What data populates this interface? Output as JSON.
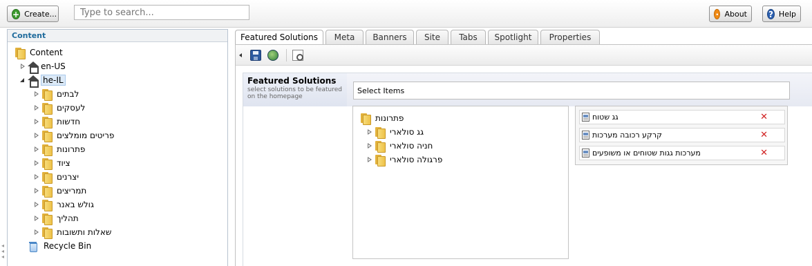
{
  "topbar": {
    "create_label": "Create...",
    "search_placeholder": "Type to search...",
    "about_label": "About",
    "help_label": "Help"
  },
  "content_tree": {
    "header": "Content",
    "root": "Content",
    "en_us": "en-US",
    "he_il": "he-IL",
    "he_children": [
      "לבתים",
      "לעסקים",
      "חדשות",
      "פריטים מומלצים",
      "פתרונות",
      "ציוד",
      "יצרנים",
      "תמריצים",
      "גולש באנר",
      "תהליך",
      "שאלות ותשובות"
    ],
    "recycle_bin": "Recycle Bin"
  },
  "tabs": [
    "Featured Solutions",
    "Meta",
    "Banners",
    "Site",
    "Tabs",
    "Spotlight",
    "Properties"
  ],
  "field": {
    "title": "Featured Solutions",
    "description": "select solutions to be featured on the homepage",
    "select_header": "Select Items",
    "source_root": "פתרונות",
    "source_children": [
      "גג סולארי",
      "חניה סולארי",
      "פרגולה סולארי"
    ],
    "selected_items": [
      "גג שטוח",
      "קרקע רכובה מערכות",
      "מערכות גגות שטוחים או משופעים"
    ],
    "remove_glyph": "✕"
  },
  "icons": {
    "create": "add-icon",
    "about": "about-icon",
    "help": "help-icon",
    "save": "save-icon",
    "publish": "publish-icon",
    "preview": "preview-icon"
  }
}
